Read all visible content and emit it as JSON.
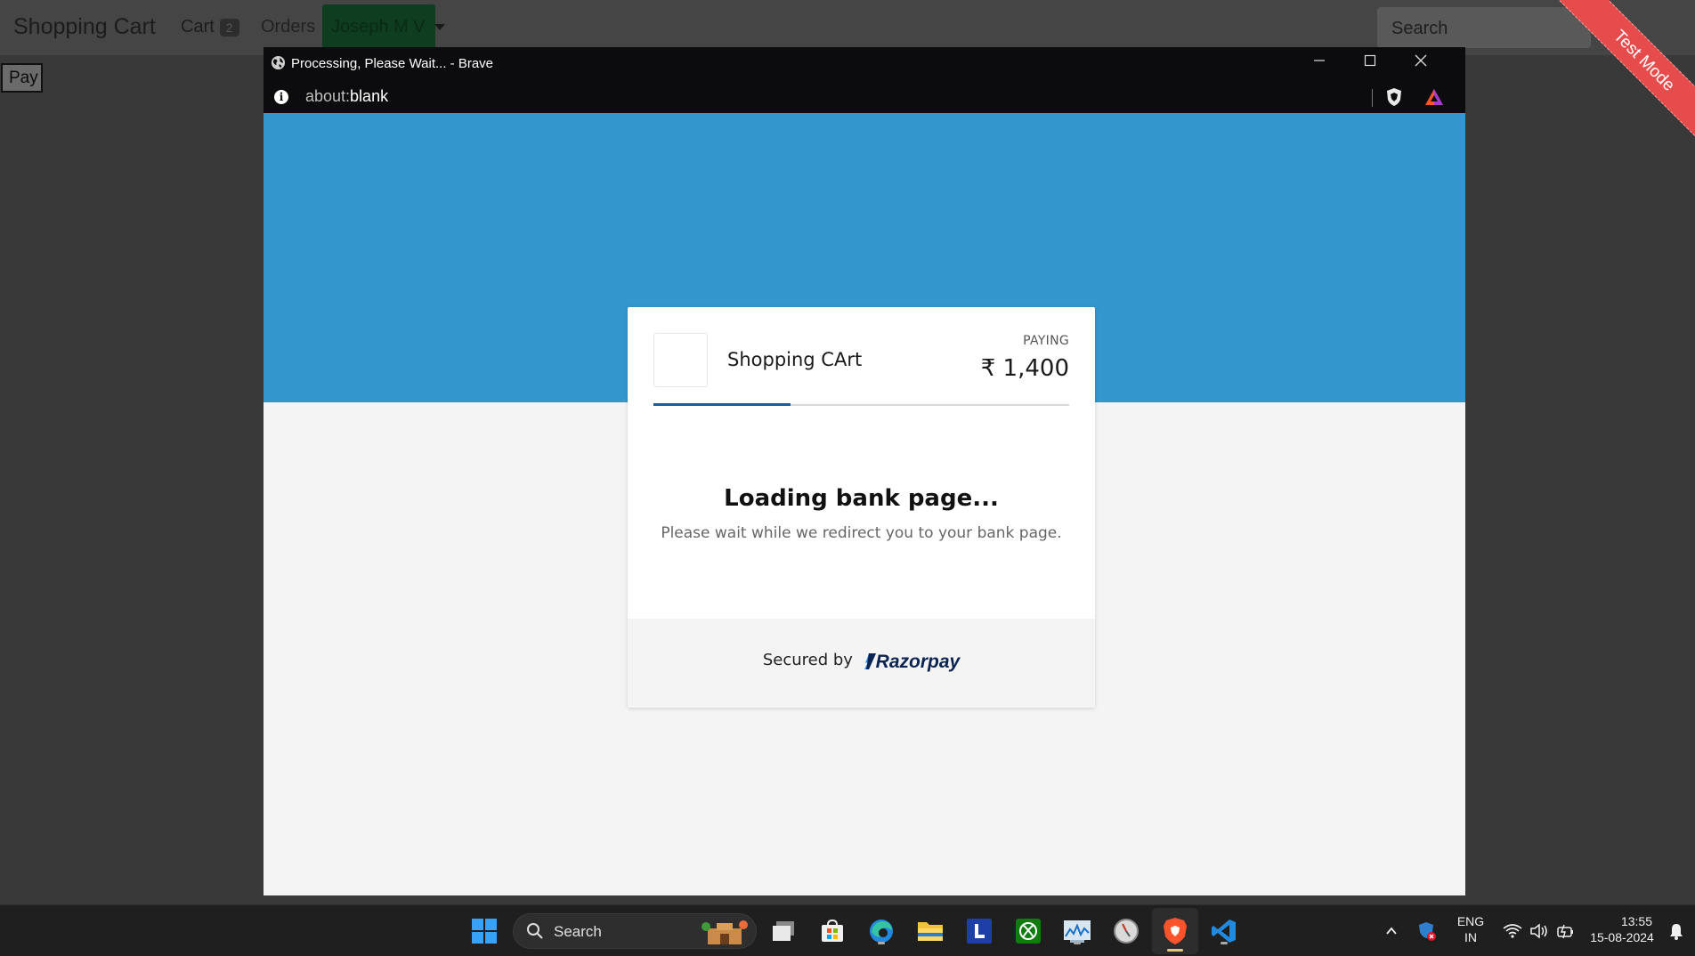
{
  "background_page": {
    "brand": "Shopping Cart",
    "nav": {
      "cart_label": "Cart",
      "cart_count": "2",
      "orders_label": "Orders",
      "user_label": "Joseph M V"
    },
    "search_placeholder": "Search",
    "pay_button": "Pay"
  },
  "test_mode_ribbon": "Test Mode",
  "popup_window": {
    "title": "Processing, Please Wait... - Brave",
    "url_prefix": "about:",
    "url_path": "blank"
  },
  "checkout": {
    "merchant_name": "Shopping CArt",
    "paying_label": "PAYING",
    "amount": "₹ 1,400",
    "progress": 0.33,
    "loading_title": "Loading bank page...",
    "loading_subtitle": "Please wait while we redirect you to your bank page.",
    "secured_by": "Secured by",
    "brand_logo_text": "Razorpay"
  },
  "taskbar": {
    "search_label": "Search",
    "apps": [
      "windows-start-icon",
      "task-view-icon",
      "microsoft-store-icon",
      "edge-icon",
      "file-explorer-icon",
      "l-app-icon",
      "xbox-icon",
      "resource-monitor-icon",
      "clock-app-icon",
      "brave-icon",
      "vscode-icon"
    ],
    "language_line1": "ENG",
    "language_line2": "IN",
    "time": "13:55",
    "date": "15-08-2024"
  },
  "colors": {
    "hero_blue": "#3396cc",
    "progress": "#1a5d9a",
    "ribbon": "#e74c4c",
    "razorpay_navy": "#0c2451"
  }
}
